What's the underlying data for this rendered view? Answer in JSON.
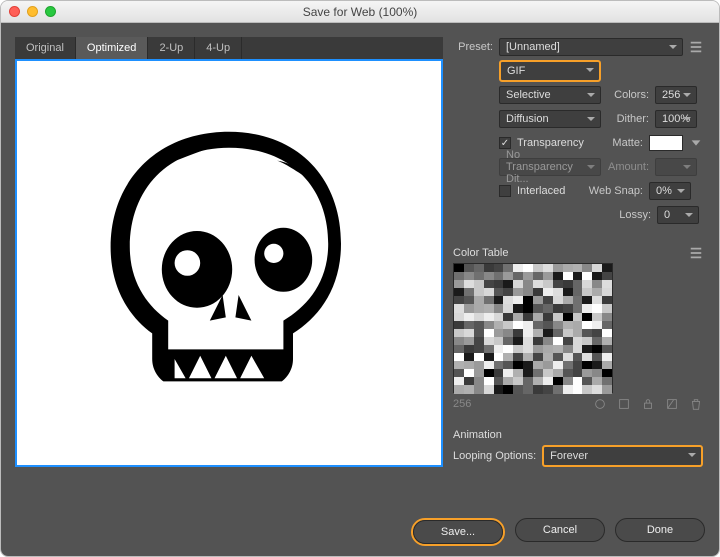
{
  "window": {
    "title": "Save for Web (100%)"
  },
  "tabs": [
    {
      "label": "Original"
    },
    {
      "label": "Optimized"
    },
    {
      "label": "2-Up"
    },
    {
      "label": "4-Up"
    }
  ],
  "preset": {
    "label": "Preset:",
    "value": "[Unnamed]"
  },
  "format": {
    "value": "GIF"
  },
  "reduction": {
    "value": "Selective"
  },
  "dither_method": {
    "value": "Diffusion"
  },
  "transparency": {
    "label": "Transparency"
  },
  "transp_dither": {
    "value": "No Transparency Dit..."
  },
  "interlaced": {
    "label": "Interlaced"
  },
  "colors": {
    "label": "Colors:",
    "value": "256"
  },
  "dither": {
    "label": "Dither:",
    "value": "100%"
  },
  "matte": {
    "label": "Matte:"
  },
  "amount": {
    "label": "Amount:",
    "value": ""
  },
  "websnap": {
    "label": "Web Snap:",
    "value": "0%"
  },
  "lossy": {
    "label": "Lossy:",
    "value": "0"
  },
  "color_table": {
    "title": "Color Table",
    "count": "256"
  },
  "animation": {
    "title": "Animation",
    "looping_label": "Looping Options:",
    "looping_value": "Forever"
  },
  "buttons": {
    "save": "Save...",
    "cancel": "Cancel",
    "done": "Done"
  },
  "ct_shades": [
    "#000",
    "#fff",
    "#d8d8d8",
    "#707070",
    "#b0b0b0",
    "#3a3a3a",
    "#9a9a9a",
    "#555",
    "#c8c8c8",
    "#1a1a1a",
    "#eee",
    "#888",
    "#444",
    "#aaa",
    "#666",
    "#ddd"
  ]
}
